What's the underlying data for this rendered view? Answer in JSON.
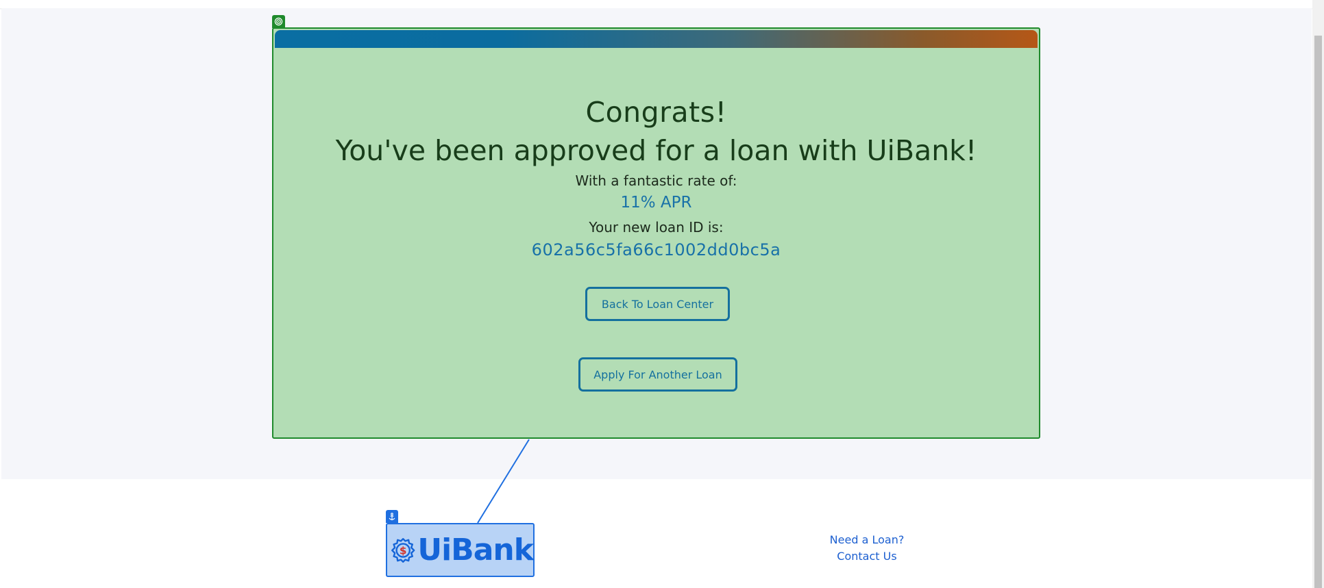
{
  "approval": {
    "heading_line1": "Congrats!",
    "heading_line2": "You've been approved for a loan with UiBank!",
    "rate_label": "With a fantastic rate of:",
    "rate_value": "11% APR",
    "loan_id_label": "Your new loan ID is:",
    "loan_id_value": "602a56c5fa66c1002dd0bc5a"
  },
  "actions": {
    "back_label": "Back To Loan Center",
    "apply_label": "Apply For Another Loan"
  },
  "brand": {
    "logo_text": "UiBank",
    "logo_symbol": "$"
  },
  "footer": {
    "links": [
      "Need a Loan?",
      "Contact Us"
    ]
  },
  "colors": {
    "card_background": "#b3ddb5",
    "card_border": "#1f8a2c",
    "accent_blue": "#14709e",
    "link_blue": "#1c5fd0",
    "logo_blue": "#1565d8"
  },
  "icons": {
    "card_marker": "target-icon",
    "logo_marker": "anchor-icon"
  }
}
